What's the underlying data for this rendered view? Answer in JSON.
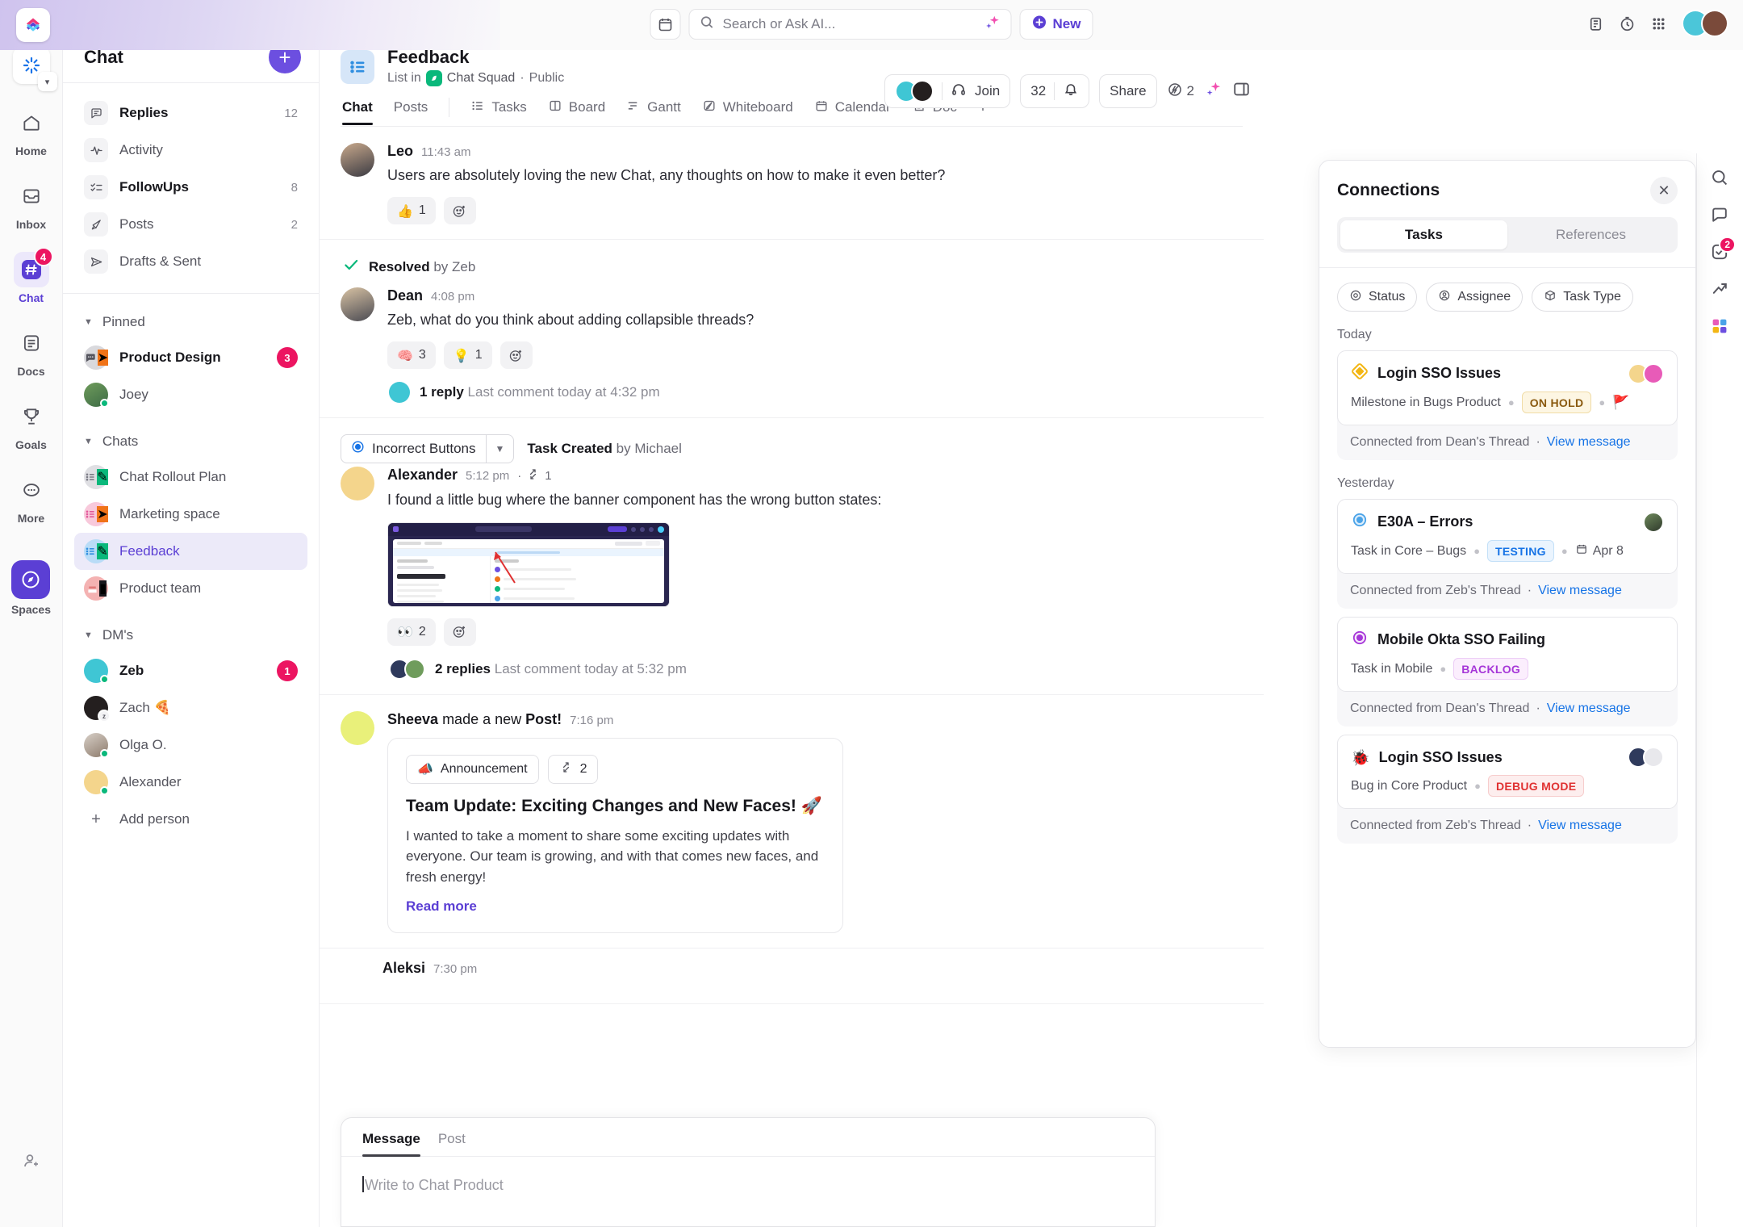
{
  "topbar": {
    "calendar_icon": "calendar-icon",
    "search": {
      "placeholder": "Search or Ask AI...",
      "icon": "search-icon",
      "ai_icon": "sparkle-icon"
    },
    "new_button": {
      "label": "New",
      "icon": "plus-circle-icon"
    },
    "right_icons": [
      "clipboard-icon",
      "timer-icon",
      "apps-grid-icon"
    ],
    "avatars": [
      "user-avatar-1",
      "user-avatar-2"
    ]
  },
  "rail": {
    "top_icon": "workspace-loading-icon",
    "items": [
      {
        "label": "Home",
        "icon": "home-icon",
        "badge": ""
      },
      {
        "label": "Inbox",
        "icon": "inbox-icon",
        "badge": ""
      },
      {
        "label": "Chat",
        "icon": "hash-icon",
        "badge": "4",
        "active": true
      },
      {
        "label": "Docs",
        "icon": "docs-icon",
        "badge": ""
      },
      {
        "label": "Goals",
        "icon": "trophy-icon",
        "badge": ""
      },
      {
        "label": "More",
        "icon": "ellipsis-icon",
        "badge": ""
      }
    ],
    "spaces": {
      "label": "Spaces",
      "icon": "spaces-icon"
    },
    "bottom": {
      "icon": "add-person-icon"
    }
  },
  "sidebar": {
    "title": "Chat",
    "add_button": "+",
    "nav": [
      {
        "label": "Replies",
        "icon": "replies-icon",
        "count": "12",
        "bold": true
      },
      {
        "label": "Activity",
        "icon": "activity-icon",
        "count": "",
        "bold": false
      },
      {
        "label": "FollowUps",
        "icon": "followups-icon",
        "count": "8",
        "bold": true
      },
      {
        "label": "Posts",
        "icon": "posts-megaphone-icon",
        "count": "2",
        "bold": false
      },
      {
        "label": "Drafts & Sent",
        "icon": "send-icon",
        "count": "",
        "bold": false
      }
    ],
    "sections": [
      {
        "name": "Pinned",
        "items": [
          {
            "label": "Product Design",
            "badge": "3",
            "bold": true,
            "avatar": "chat-bubble-avatar",
            "status": ""
          },
          {
            "label": "Joey",
            "badge": "",
            "bold": false,
            "avatar": "joey-avatar",
            "status": "online"
          }
        ]
      },
      {
        "name": "Chats",
        "items": [
          {
            "label": "Chat Rollout Plan",
            "badge": "",
            "bold": false,
            "avatar": "list-avatar-gray",
            "status": ""
          },
          {
            "label": "Marketing space",
            "badge": "",
            "bold": false,
            "avatar": "list-avatar-pink",
            "status": ""
          },
          {
            "label": "Feedback",
            "badge": "",
            "bold": false,
            "avatar": "list-avatar-blue",
            "status": "",
            "selected": true
          },
          {
            "label": "Product team",
            "badge": "",
            "bold": false,
            "avatar": "list-avatar-red",
            "status": ""
          }
        ]
      },
      {
        "name": "DM's",
        "items": [
          {
            "label": "Zeb",
            "badge": "1",
            "bold": true,
            "avatar": "zeb-avatar",
            "status": "online"
          },
          {
            "label": "Zach 🍕",
            "badge": "",
            "bold": false,
            "avatar": "zach-avatar",
            "status": "snooze"
          },
          {
            "label": "Olga O.",
            "badge": "",
            "bold": false,
            "avatar": "olga-avatar",
            "status": "online"
          },
          {
            "label": "Alexander",
            "badge": "",
            "bold": false,
            "avatar": "alexander-avatar",
            "status": "online"
          }
        ]
      }
    ],
    "add_person": "Add person"
  },
  "main_header": {
    "list_icon": "list-blue-icon",
    "title": "Feedback",
    "breadcrumb_prefix": "List in",
    "space_name": "Chat Squad",
    "visibility": "Public",
    "tabs": [
      {
        "label": "Chat",
        "icon": "",
        "active": true
      },
      {
        "label": "Posts",
        "icon": "",
        "active": false
      },
      {
        "label": "Tasks",
        "icon": "list-icon",
        "active": false
      },
      {
        "label": "Board",
        "icon": "board-icon",
        "active": false
      },
      {
        "label": "Gantt",
        "icon": "gantt-icon",
        "active": false
      },
      {
        "label": "Whiteboard",
        "icon": "whiteboard-icon",
        "active": false
      },
      {
        "label": "Calendar",
        "icon": "calendar-icon",
        "active": false
      },
      {
        "label": "Doc",
        "icon": "doc-icon",
        "active": false
      },
      {
        "label": "+",
        "icon": "plus-icon",
        "active": false
      }
    ],
    "join_label": "Join",
    "join_icon": "headphones-icon",
    "member_count": "32",
    "bell_icon": "bell-icon",
    "share_label": "Share",
    "automations_count": "2",
    "automations_icon": "bolt-slash-icon",
    "ai_icon": "sparkle-icon",
    "panel_icon": "right-panel-icon"
  },
  "messages": [
    {
      "id": "leo",
      "author": "Leo",
      "time": "11:43 am",
      "text": "Users are absolutely loving the new Chat, any thoughts on how to make it even better?",
      "reactions": [
        {
          "emoji": "👍",
          "count": "1"
        }
      ],
      "avatar": "leo-avatar"
    },
    {
      "id": "dean",
      "resolved_label": "Resolved",
      "resolved_by": "by Zeb",
      "author": "Dean",
      "time": "4:08 pm",
      "text": "Zeb, what do you think about adding collapsible threads?",
      "reactions": [
        {
          "emoji": "🧠",
          "count": "3"
        },
        {
          "emoji": "💡",
          "count": "1"
        }
      ],
      "thread": {
        "count_label": "1 reply",
        "last": "Last comment today at 4:32 pm"
      },
      "avatar": "dean-avatar"
    },
    {
      "id": "alexander",
      "task_chip": "Incorrect Buttons",
      "task_created_label": "Task Created",
      "task_created_by": "by Michael",
      "author": "Alexander",
      "time": "5:12 pm",
      "link_count": "1",
      "text": "I found a little bug where the banner component has the wrong button states:",
      "attachment": "task-screenshot",
      "reactions": [
        {
          "emoji": "👀",
          "count": "2"
        }
      ],
      "thread": {
        "count_label": "2 replies",
        "last": "Last comment today at 5:32 pm"
      },
      "avatar": "alexander-avatar"
    },
    {
      "id": "sheeva",
      "author": "Sheeva",
      "action_text": "made a new",
      "action_bold": "Post!",
      "time": "7:16 pm",
      "avatar": "sheeva-avatar",
      "post": {
        "badge": "Announcement",
        "badge_icon": "megaphone-icon",
        "link_count": "2",
        "title": "Team Update: Exciting Changes and New Faces! 🚀",
        "body": "I wanted to take a moment to share some exciting updates with everyone. Our team is growing, and with that comes new faces, and fresh energy!",
        "read_more": "Read more"
      }
    },
    {
      "id": "aleksi",
      "author": "Aleksi",
      "time": "7:30 pm",
      "avatar": "aleksi-avatar"
    }
  ],
  "composer": {
    "tabs": [
      {
        "label": "Message",
        "active": true
      },
      {
        "label": "Post",
        "active": false
      }
    ],
    "placeholder": "Write to Chat Product"
  },
  "connections": {
    "title": "Connections",
    "close_icon": "close-icon",
    "tabs": [
      {
        "label": "Tasks",
        "active": true
      },
      {
        "label": "References",
        "active": false
      }
    ],
    "filters": [
      {
        "label": "Status",
        "icon": "status-circle-icon"
      },
      {
        "label": "Assignee",
        "icon": "assignee-icon"
      },
      {
        "label": "Task Type",
        "icon": "cube-icon"
      }
    ],
    "groups": [
      {
        "label": "Today",
        "items": [
          {
            "icon": "milestone-diamond-icon",
            "icon_color": "#f3b614",
            "name": "Login SSO Issues",
            "subtitle": "Milestone in Bugs Product",
            "status": {
              "label": "ON HOLD",
              "color": "#8a5a10",
              "bg": "#fdf6e3",
              "border": "#f0dca7"
            },
            "flag": "red-flag-icon",
            "due": "",
            "avatars": [
              "assignee-1",
              "assignee-2"
            ],
            "connected_from": "Connected from Dean's Thread",
            "view_link": "View message"
          }
        ]
      },
      {
        "label": "Yesterday",
        "items": [
          {
            "icon": "status-ring-icon",
            "icon_color": "#4aa3e8",
            "name": "E30A – Errors",
            "subtitle": "Task in Core – Bugs",
            "status": {
              "label": "TESTING",
              "color": "#1673e6",
              "bg": "#eaf4fe",
              "border": "#c4e0f8"
            },
            "flag": "",
            "due": "Apr 8",
            "due_icon": "calendar-icon",
            "avatars": [
              "assignee-3"
            ],
            "connected_from": "Connected from Zeb's Thread",
            "view_link": "View message"
          },
          {
            "icon": "status-ring-icon",
            "icon_color": "#a636d8",
            "name": "Mobile Okta SSO Failing",
            "subtitle": "Task in Mobile",
            "status": {
              "label": "BACKLOG",
              "color": "#a636d8",
              "bg": "#fbeefd",
              "border": "#eccdf6"
            },
            "flag": "",
            "due": "",
            "avatars": [],
            "connected_from": "Connected from Dean's Thread",
            "view_link": "View message"
          },
          {
            "icon": "bug-icon",
            "icon_color": "#e03131",
            "name": "Login SSO Issues",
            "subtitle": "Bug in Core Product",
            "status": {
              "label": "DEBUG MODE",
              "color": "#e03131",
              "bg": "#fdeeee",
              "border": "#f7cdcd"
            },
            "flag": "",
            "due": "",
            "avatars": [
              "assignee-4",
              "assignee-5"
            ],
            "connected_from": "Connected from Zeb's Thread",
            "view_link": "View message"
          }
        ]
      }
    ]
  },
  "edge_rail": {
    "icons": [
      {
        "name": "search-icon",
        "badge": ""
      },
      {
        "name": "comment-icon",
        "badge": ""
      },
      {
        "name": "check-circle-icon",
        "badge": "2"
      },
      {
        "name": "activity-arrow-icon",
        "badge": ""
      },
      {
        "name": "apps-icon",
        "badge": ""
      }
    ]
  },
  "colors": {
    "accent": "#5b3fd4",
    "badge": "#ec1561",
    "link": "#1673e6",
    "green": "#0ab87b"
  }
}
